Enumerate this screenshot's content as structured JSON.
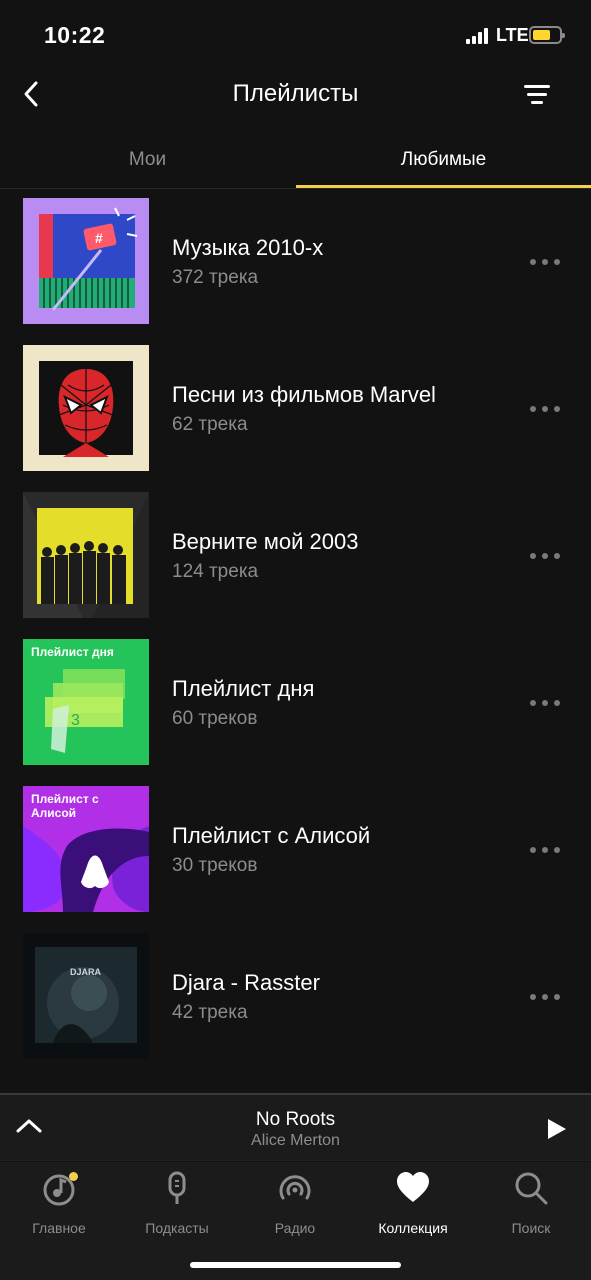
{
  "status": {
    "time": "10:22",
    "network": "LTE"
  },
  "nav": {
    "title": "Плейлисты"
  },
  "tabs": [
    {
      "label": "Мои",
      "active": false
    },
    {
      "label": "Любимые",
      "active": true
    }
  ],
  "playlists": [
    {
      "title": "Музыка 2010-х",
      "count": "372 трека",
      "cover_text": "#"
    },
    {
      "title": "Песни из фильмов Marvel",
      "count": "62 трека"
    },
    {
      "title": "Верните мой 2003",
      "count": "124 трека"
    },
    {
      "title": "Плейлист дня",
      "count": "60 треков",
      "cover_text": "Плейлист дня",
      "cover_badge": "3"
    },
    {
      "title": "Плейлист с Алисой",
      "count": "30 треков",
      "cover_text": "Плейлист с Алисой"
    },
    {
      "title": "Djara - Rasster",
      "count": "42 трека",
      "cover_text": "DJARA"
    }
  ],
  "now_playing": {
    "title": "No Roots",
    "artist": "Alice Merton"
  },
  "bottom_tabs": [
    {
      "label": "Главное",
      "icon": "home-music-icon",
      "active": false
    },
    {
      "label": "Подкасты",
      "icon": "microphone-icon",
      "active": false
    },
    {
      "label": "Радио",
      "icon": "radio-icon",
      "active": false
    },
    {
      "label": "Коллекция",
      "icon": "heart-icon",
      "active": true
    },
    {
      "label": "Поиск",
      "icon": "search-icon",
      "active": false
    }
  ],
  "colors": {
    "accent": "#f5cf4b",
    "background": "#121212",
    "bar": "#1b1b1b"
  }
}
